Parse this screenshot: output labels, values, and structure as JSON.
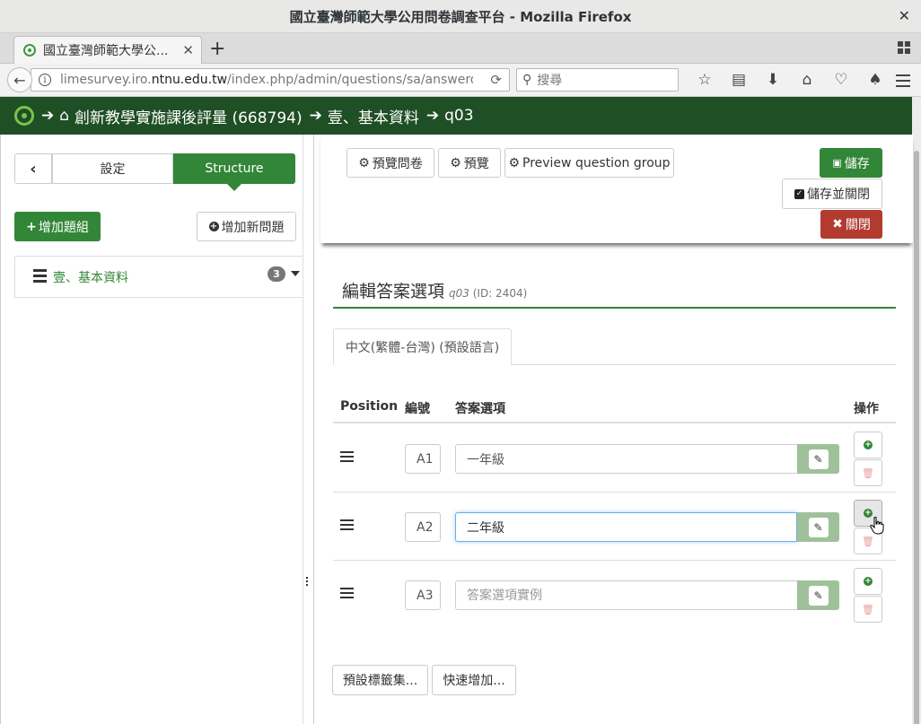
{
  "window": {
    "title": "國立臺灣師範大學公用問卷調查平台 - Mozilla Firefox",
    "close_glyph": "✕"
  },
  "browser": {
    "tab_title": "國立臺灣師範大學公...",
    "tab_close": "✕",
    "new_tab": "+",
    "url_host_prefix": "limesurvey.iro.",
    "url_host_domain": "ntnu.edu.tw",
    "url_path": "/index.php/admin/questions/sa/answeropti",
    "search_placeholder": "搜尋"
  },
  "breadcrumb": {
    "survey": "創新教學實施課後評量 (668794)",
    "group": "壹、基本資料",
    "question": "q03"
  },
  "sidebar": {
    "tab_settings": "設定",
    "tab_structure": "Structure",
    "add_group": "增加題組",
    "add_question": "增加新問題",
    "groups": [
      {
        "name": "壹、基本資料",
        "count": "3"
      }
    ]
  },
  "toolbar": {
    "preview_survey": "預覽問卷",
    "preview": "預覽",
    "preview_group": "Preview question group",
    "save": "儲存",
    "save_close": "儲存並關閉",
    "close": "關閉"
  },
  "editor": {
    "title": "編輯答案選項",
    "question_code": "q03",
    "question_id": "(ID: 2404)",
    "language_tab": "中文(繁體-台灣) (預設語言)",
    "columns": {
      "position": "Position",
      "code": "編號",
      "answer": "答案選項",
      "actions": "操作"
    },
    "rows": [
      {
        "code": "A1",
        "answer": "一年級",
        "placeholder": ""
      },
      {
        "code": "A2",
        "answer": "二年級",
        "placeholder": ""
      },
      {
        "code": "A3",
        "answer": "",
        "placeholder": "答案選項實例"
      }
    ],
    "predefined_label_sets": "預設標籤集...",
    "quick_add": "快速增加..."
  },
  "colors": {
    "brand_dark": "#1f4f24",
    "accent_green": "#328637",
    "danger": "#b23a2f",
    "focus_blue": "#66afe9"
  }
}
